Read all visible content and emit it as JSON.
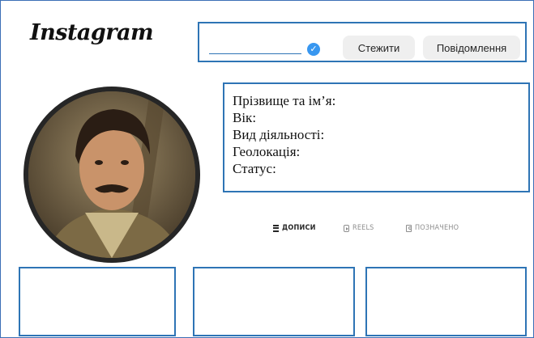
{
  "app": {
    "logo": "Instagram"
  },
  "profile": {
    "username": "",
    "follow_label": "Стежити",
    "message_label": "Повідомлення"
  },
  "info": {
    "lines": [
      "Прізвище та ім’я:",
      "Вік:",
      "Вид діяльності:",
      "Геолокація:",
      "Статус:"
    ]
  },
  "tabs": [
    {
      "label": "ДОПИСИ",
      "icon": "grid-icon",
      "active": true
    },
    {
      "label": "REELS",
      "icon": "reels-icon",
      "active": false
    },
    {
      "label": "ПОЗНАЧЕНО",
      "icon": "tagged-icon",
      "active": false
    }
  ],
  "posts": [
    "",
    "",
    ""
  ],
  "colors": {
    "frame_blue": "#2e74b5",
    "verified_blue": "#3897f0",
    "button_bg": "#efefef",
    "active_tab": "#262626",
    "inactive_tab": "#8e8e8e"
  }
}
